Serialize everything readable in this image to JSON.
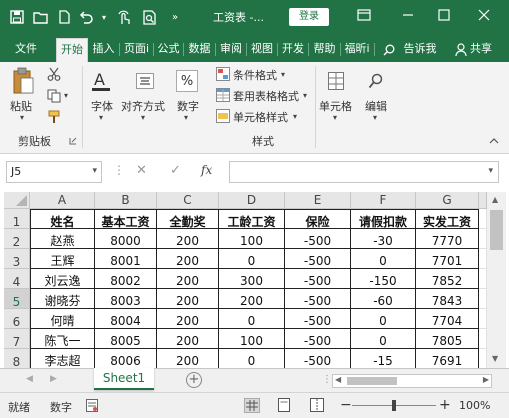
{
  "app": {
    "title": "工资表 -...",
    "login_label": "登录",
    "accent_color": "#217346"
  },
  "quick_access": [
    "save-icon",
    "open-folder-icon",
    "new-file-icon",
    "undo-icon",
    "touch-mode-icon",
    "print-preview-icon",
    "more-commands-icon"
  ],
  "ribbon_tabs": [
    "文件",
    "开始",
    "插入",
    "页面i",
    "公式",
    "数据",
    "审阅",
    "视图",
    "开发",
    "帮助",
    "福昕i"
  ],
  "active_tab": "开始",
  "tell_me": "告诉我",
  "share_label": "共享",
  "ribbon": {
    "clipboard": {
      "paste": "粘贴",
      "group_label": "剪贴板"
    },
    "font": {
      "label": "字体"
    },
    "alignment": {
      "label": "对齐方式"
    },
    "number": {
      "label": "数字",
      "symbol": "%"
    },
    "styles": {
      "conditional": "条件格式",
      "table": "套用表格格式",
      "cell": "单元格样式",
      "group_label": "样式"
    },
    "cells": {
      "label": "单元格"
    },
    "editing": {
      "label": "编辑"
    }
  },
  "formula_bar": {
    "name_box": "J5",
    "cancel": "✕",
    "enter": "✓",
    "fx": "fx",
    "formula": ""
  },
  "sheet": {
    "columns": [
      "A",
      "B",
      "C",
      "D",
      "E",
      "F",
      "G"
    ],
    "row_numbers": [
      "1",
      "2",
      "3",
      "4",
      "5",
      "6",
      "7",
      "8"
    ],
    "selected_row": "5",
    "headers": [
      "姓名",
      "基本工资",
      "全勤奖",
      "工龄工资",
      "保险",
      "请假扣款",
      "实发工资"
    ],
    "rows": [
      [
        "赵燕",
        "8000",
        "200",
        "100",
        "-500",
        "-30",
        "7770"
      ],
      [
        "王辉",
        "8001",
        "200",
        "0",
        "-500",
        "0",
        "7701"
      ],
      [
        "刘云逸",
        "8002",
        "200",
        "300",
        "-500",
        "-150",
        "7852"
      ],
      [
        "谢晓芬",
        "8003",
        "200",
        "200",
        "-500",
        "-60",
        "7843"
      ],
      [
        "何晴",
        "8004",
        "200",
        "0",
        "-500",
        "0",
        "7704"
      ],
      [
        "陈飞一",
        "8005",
        "200",
        "100",
        "-500",
        "0",
        "7805"
      ],
      [
        "李志超",
        "8006",
        "200",
        "0",
        "-500",
        "-15",
        "7691"
      ]
    ]
  },
  "sheet_tabs": [
    "Sheet1"
  ],
  "status": {
    "ready": "就绪",
    "mode": "数字",
    "zoom": "100%",
    "zoom_minus": "−",
    "zoom_plus": "+"
  }
}
